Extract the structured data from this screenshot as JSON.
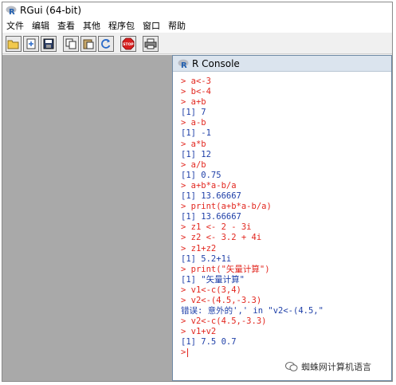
{
  "window": {
    "title": "RGui (64-bit)"
  },
  "menubar": {
    "items": [
      "文件",
      "编辑",
      "查看",
      "其他",
      "程序包",
      "窗口",
      "帮助"
    ]
  },
  "toolbar": {
    "buttons": [
      "open-script-icon",
      "load-workspace-icon",
      "save-icon",
      "copy-icon",
      "paste-icon",
      "refresh-icon",
      "stop-icon",
      "print-icon"
    ],
    "stop_label": "STOP"
  },
  "console": {
    "title": "R Console",
    "lines": [
      {
        "type": "in",
        "text": "> a<-3"
      },
      {
        "type": "in",
        "text": "> b<-4"
      },
      {
        "type": "in",
        "text": "> a+b"
      },
      {
        "type": "out",
        "text": "[1] 7"
      },
      {
        "type": "in",
        "text": "> a-b"
      },
      {
        "type": "out",
        "text": "[1] -1"
      },
      {
        "type": "in",
        "text": "> a*b"
      },
      {
        "type": "out",
        "text": "[1] 12"
      },
      {
        "type": "in",
        "text": "> a/b"
      },
      {
        "type": "out",
        "text": "[1] 0.75"
      },
      {
        "type": "in",
        "text": "> a+b*a-b/a"
      },
      {
        "type": "out",
        "text": "[1] 13.66667"
      },
      {
        "type": "in",
        "text": "> print(a+b*a-b/a)"
      },
      {
        "type": "out",
        "text": "[1] 13.66667"
      },
      {
        "type": "in",
        "text": "> z1 <- 2 - 3i"
      },
      {
        "type": "in",
        "text": "> z2 <- 3.2 + 4i"
      },
      {
        "type": "in",
        "text": "> z1+z2"
      },
      {
        "type": "out",
        "text": "[1] 5.2+1i"
      },
      {
        "type": "in",
        "text": "> print(\"矢量计算\")"
      },
      {
        "type": "out",
        "text": "[1] \"矢量计算\""
      },
      {
        "type": "in",
        "text": "> v1<-c(3,4)"
      },
      {
        "type": "in",
        "text": "> v2<-(4.5,-3.3)"
      },
      {
        "type": "err",
        "text": "错误: 意外的',' in \"v2<-(4.5,\""
      },
      {
        "type": "in",
        "text": "> v2<-c(4.5,-3.3)"
      },
      {
        "type": "in",
        "text": "> v1+v2"
      },
      {
        "type": "out",
        "text": "[1] 7.5 0.7"
      }
    ],
    "prompt": ">"
  },
  "watermark": {
    "text": "蜘蛛网计算机语言"
  },
  "colors": {
    "input": "#e2271f",
    "output": "#1e3fa8",
    "mdi_background": "#a9a9a9"
  }
}
